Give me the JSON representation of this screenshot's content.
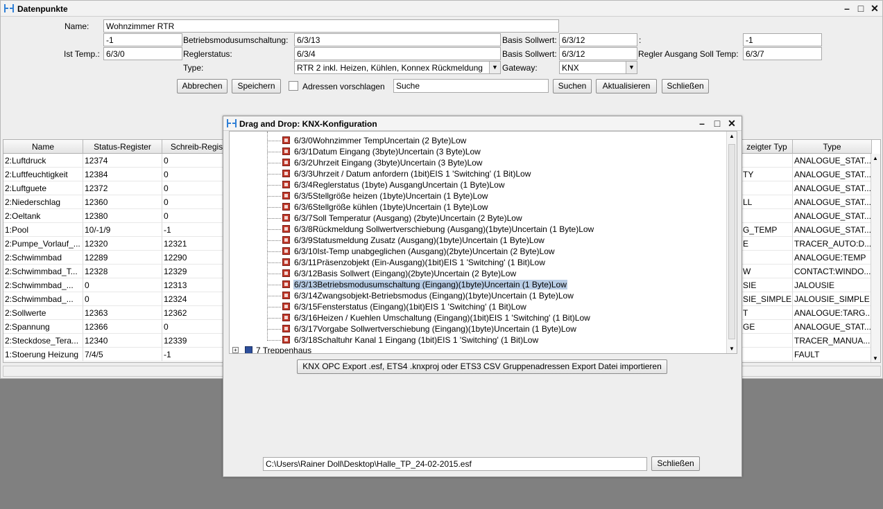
{
  "window": {
    "title": "Datenpunkte",
    "controls": {
      "minimize": "–",
      "maximize": "□",
      "close": "✕"
    }
  },
  "form": {
    "name_label": "Name:",
    "name_value": "Wohnzimmer RTR",
    "row1": {
      "left_value": "-1",
      "mode_label": "Betriebsmodusumschaltung:",
      "mode_value": "6/3/13",
      "basis_label": "Basis Sollwert:",
      "basis_value": "6/3/12",
      "colon_label": ":",
      "right_value": "-1"
    },
    "row2": {
      "ist_label": "Ist Temp.:",
      "ist_value": "6/3/0",
      "regler_label": "Reglerstatus:",
      "regler_value": "6/3/4",
      "basis_label": "Basis Sollwert:",
      "basis_value": "6/3/12",
      "ausgang_label": "Regler Ausgang Soll Temp:",
      "ausgang_value": "6/3/7"
    },
    "row3": {
      "type_label": "Type:",
      "type_value": "RTR 2 inkl. Heizen, Kühlen, Konnex Rückmeldung",
      "gateway_label": "Gateway:",
      "gateway_value": "KNX"
    },
    "buttons": {
      "cancel": "Abbrechen",
      "save": "Speichern",
      "suggest_label": "Adressen vorschlagen",
      "search_value": "Suche",
      "search": "Suchen",
      "refresh": "Aktualisieren",
      "close": "Schließen"
    }
  },
  "table": {
    "columns": [
      "Name",
      "Status-Register",
      "Schreib-Regis",
      "zeigter Typ",
      "Type"
    ],
    "rows": [
      {
        "name": "2:Luftdruck",
        "status": "12374",
        "write": "0",
        "shown": "",
        "type": "ANALOGUE_STAT..."
      },
      {
        "name": "2:Luftfeuchtigkeit",
        "status": "12384",
        "write": "0",
        "shown": "TY",
        "type": "ANALOGUE_STAT..."
      },
      {
        "name": "2:Luftguete",
        "status": "12372",
        "write": "0",
        "shown": "",
        "type": "ANALOGUE_STAT..."
      },
      {
        "name": "2:Niederschlag",
        "status": "12360",
        "write": "0",
        "shown": "LL",
        "type": "ANALOGUE_STAT..."
      },
      {
        "name": "2:Oeltank",
        "status": "12380",
        "write": "0",
        "shown": "",
        "type": "ANALOGUE_STAT..."
      },
      {
        "name": "1:Pool",
        "status": "10/-1/9",
        "write": "-1",
        "shown": "G_TEMP",
        "type": "ANALOGUE_STAT..."
      },
      {
        "name": "2:Pumpe_Vorlauf_...",
        "status": "12320",
        "write": "12321",
        "shown": "E",
        "type": "TRACER_AUTO:D..."
      },
      {
        "name": "2:Schwimmbad",
        "status": "12289",
        "write": "12290",
        "shown": "",
        "type": "ANALOGUE:TEMP"
      },
      {
        "name": "2:Schwimmbad_T...",
        "status": "12328",
        "write": "12329",
        "shown": "W",
        "type": "CONTACT:WINDO..."
      },
      {
        "name": "2:Schwimmbad_...",
        "status": "0",
        "write": "12313",
        "shown": "SIE",
        "type": "JALOUSIE"
      },
      {
        "name": "2:Schwimmbad_...",
        "status": "0",
        "write": "12324",
        "shown": "SIE_SIMPLE",
        "type": "JALOUSIE_SIMPLE"
      },
      {
        "name": "2:Sollwerte",
        "status": "12363",
        "write": "12362",
        "shown": "T",
        "type": "ANALOGUE:TARG..."
      },
      {
        "name": "2:Spannung",
        "status": "12366",
        "write": "0",
        "shown": "GE",
        "type": "ANALOGUE_STAT..."
      },
      {
        "name": "2:Steckdose_Tera...",
        "status": "12340",
        "write": "12339",
        "shown": "",
        "type": "TRACER_MANUA..."
      },
      {
        "name": "1:Stoerung Heizung",
        "status": "7/4/5",
        "write": "-1",
        "shown": "",
        "type": "FAULT"
      }
    ]
  },
  "dialog": {
    "title": "Drag and Drop: KNX-Konfiguration",
    "items": [
      "6/3/0Wohnzimmer TempUncertain (2 Byte)Low",
      "6/3/1Datum Eingang (3byte)Uncertain (3 Byte)Low",
      "6/3/2Uhrzeit Eingang (3byte)Uncertain (3 Byte)Low",
      "6/3/3Uhrzeit / Datum anfordern (1bit)EIS 1 'Switching' (1 Bit)Low",
      "6/3/4Reglerstatus (1byte) AusgangUncertain (1 Byte)Low",
      "6/3/5Stellgröße heizen (1byte)Uncertain (1 Byte)Low",
      "6/3/6Stellgröße kühlen (1byte)Uncertain (1 Byte)Low",
      "6/3/7Soll Temperatur (Ausgang) (2byte)Uncertain (2 Byte)Low",
      "6/3/8Rückmeldung Sollwertverschiebung (Ausgang)(1byte)Uncertain (1 Byte)Low",
      "6/3/9Statusmeldung Zusatz (Ausgang)(1byte)Uncertain (1 Byte)Low",
      "6/3/10Ist-Temp unabgeglichen (Ausgang)(2byte)Uncertain (2 Byte)Low",
      "6/3/11Präsenzobjekt (Ein-Ausgang)(1bit)EIS 1 'Switching' (1 Bit)Low",
      "6/3/12Basis Sollwert (Eingang)(2byte)Uncertain (2 Byte)Low",
      "6/3/13Betriebsmodusumschaltung (Eingang)(1byte)Uncertain (1 Byte)Low",
      "6/3/14Zwangsobjekt-Betriebsmodus (Eingang)(1byte)Uncertain (1 Byte)Low",
      "6/3/15Fensterstatus (Eingang)(1bit)EIS 1 'Switching' (1 Bit)Low",
      "6/3/16Heizen / Kuehlen Umschaltung (Eingang)(1bit)EIS 1 'Switching' (1 Bit)Low",
      "6/3/17Vorgabe Sollwertverschiebung (Eingang)(1byte)Uncertain (1 Byte)Low",
      "6/3/18Schaltuhr Kanal 1 Eingang (1bit)EIS 1 'Switching' (1 Bit)Low"
    ],
    "selected_index": 13,
    "folder": "7 Treppenhaus",
    "import_button": "KNX OPC Export .esf, ETS4 .knxproj oder ETS3 CSV Gruppenadressen Export Datei importieren",
    "path_value": "C:\\Users\\Rainer Doll\\Desktop\\Halle_TP_24-02-2015.esf",
    "close_button": "Schließen"
  }
}
